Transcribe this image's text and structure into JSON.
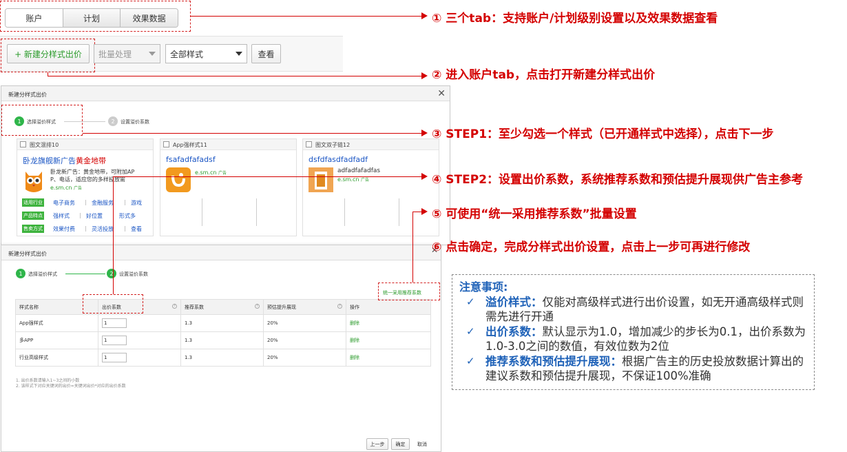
{
  "tabs": [
    "账户",
    "计划",
    "效果数据"
  ],
  "toolbar": {
    "new_button": "+ 新建分样式出价",
    "batch_select": "批量处理",
    "style_select": "全部样式",
    "view_button": "查看"
  },
  "dialog1": {
    "title": "新建分样式出价",
    "close": "✕",
    "steps": [
      {
        "num": "1",
        "label": "选择溢价样式"
      },
      {
        "num": "2",
        "label": "设置溢价系数"
      }
    ],
    "cards": [
      {
        "head": "图文混排10",
        "title_a": "卧龙旗舰新广告",
        "title_b": "黄金地带",
        "desc": [
          "卧龙新广告：黄金地带，可附加AP",
          "P、电话，适应您的多样投放需"
        ],
        "url": "e.sm.cn",
        "ad": "广告",
        "rows": [
          {
            "tag": "适用行业",
            "links": [
              "电子商务",
              "金融服务",
              "游戏"
            ]
          },
          {
            "tag": "产品特点",
            "links": [
              "强样式",
              "好位置",
              "形式多"
            ]
          },
          {
            "tag": "售卖方式",
            "links": [
              "效果付费",
              "灵活投放",
              "查看"
            ]
          }
        ]
      },
      {
        "head": "App强样式11",
        "title": "fsafadfafadsf",
        "url": "e.sm.cn",
        "ad": "广告"
      },
      {
        "head": "图文双子链12",
        "title": "dsfdfasdfadfadf",
        "sub": "adfadfafadfas",
        "url": "e.sm.cn",
        "ad": "广告"
      }
    ]
  },
  "dialog2": {
    "title": "新建分样式出价",
    "steps": [
      {
        "num": "1",
        "label": "选择溢价样式"
      },
      {
        "num": "2",
        "label": "设置溢价系数"
      }
    ],
    "batch_link": "统一采用推荐系数",
    "headers": [
      "样式名称",
      "出价系数",
      "推荐系数",
      "预估提升展现",
      "操作"
    ],
    "rows": [
      {
        "name": "App强样式",
        "bid": "1",
        "rec": "1.3",
        "lift": "20%",
        "op": "删除"
      },
      {
        "name": "多APP",
        "bid": "1",
        "rec": "1.3",
        "lift": "20%",
        "op": "删除"
      },
      {
        "name": "行业高级样式",
        "bid": "1",
        "rec": "1.3",
        "lift": "20%",
        "op": "删除"
      }
    ],
    "footnotes": [
      "1. 出价系数请输入1~3之间的小数",
      "2. 该样式下对应关键词的出价=关键词出价*对应的出价系数"
    ],
    "buttons": {
      "prev": "上一步",
      "ok": "确定",
      "cancel": "取消"
    }
  },
  "callouts": [
    "① 三个tab：支持账户/计划级别设置以及效果数据查看",
    "② 进入账户tab，点击打开新建分样式出价",
    "③ STEP1：至少勾选一个样式（已开通样式中选择），点击下一步",
    "④ STEP2：设置出价系数，系统推荐系数和预估提升展现供广告主参考",
    "⑤ 可使用“统一采用推荐系数”批量设置",
    "⑥ 点击确定，完成分样式出价设置，点击上一步可再进行修改"
  ],
  "notes": {
    "title": "注意事项:",
    "items": [
      {
        "label": "溢价样式：",
        "text": "仅能对高级样式进行出价设置，如无开通高级样式则需先进行开通"
      },
      {
        "label": "出价系数：",
        "text": "默认显示为1.0，增加减少的步长为0.1，出价系数为1.0-3.0之间的数值，有效位数为2位"
      },
      {
        "label": "推荐系数和预估提升展现：",
        "text": "根据广告主的历史投放数据计算出的建议系数和预估提升展现，不保证100%准确"
      }
    ]
  },
  "colors": {
    "accent_red": "#d40000",
    "note_blue": "#1f62b8",
    "step_green": "#2fb54a",
    "link_blue": "#1a55c4"
  }
}
